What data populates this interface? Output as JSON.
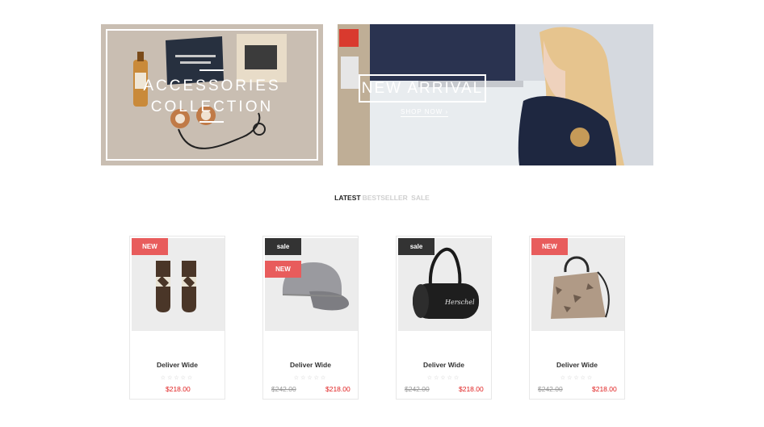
{
  "banners": {
    "accessories": {
      "title": "ACCESSORIES\nCOLLECTION"
    },
    "arrival": {
      "title": "NEW ARRIVAL",
      "cta": "SHOP NOW ›"
    }
  },
  "tabs": [
    {
      "label": "LATEST",
      "active": true
    },
    {
      "label": "BESTSELLER",
      "active": false
    },
    {
      "label": "SALE",
      "active": false
    }
  ],
  "products": [
    {
      "name": "Deliver Wide",
      "badges": [
        "NEW"
      ],
      "old_price": "",
      "price": "$218.00",
      "stars": "☆☆☆☆☆",
      "image": "mittens"
    },
    {
      "name": "Deliver Wide",
      "badges": [
        "sale",
        "NEW"
      ],
      "old_price": "$242.00",
      "price": "$218.00",
      "stars": "☆☆☆☆☆",
      "image": "cap"
    },
    {
      "name": "Deliver Wide",
      "badges": [
        "sale"
      ],
      "old_price": "$242.00",
      "price": "$218.00",
      "stars": "☆☆☆☆☆",
      "image": "duffel-bag"
    },
    {
      "name": "Deliver Wide",
      "badges": [
        "NEW"
      ],
      "old_price": "$242.00",
      "price": "$218.00",
      "stars": "☆☆☆☆☆",
      "image": "handbag"
    }
  ]
}
